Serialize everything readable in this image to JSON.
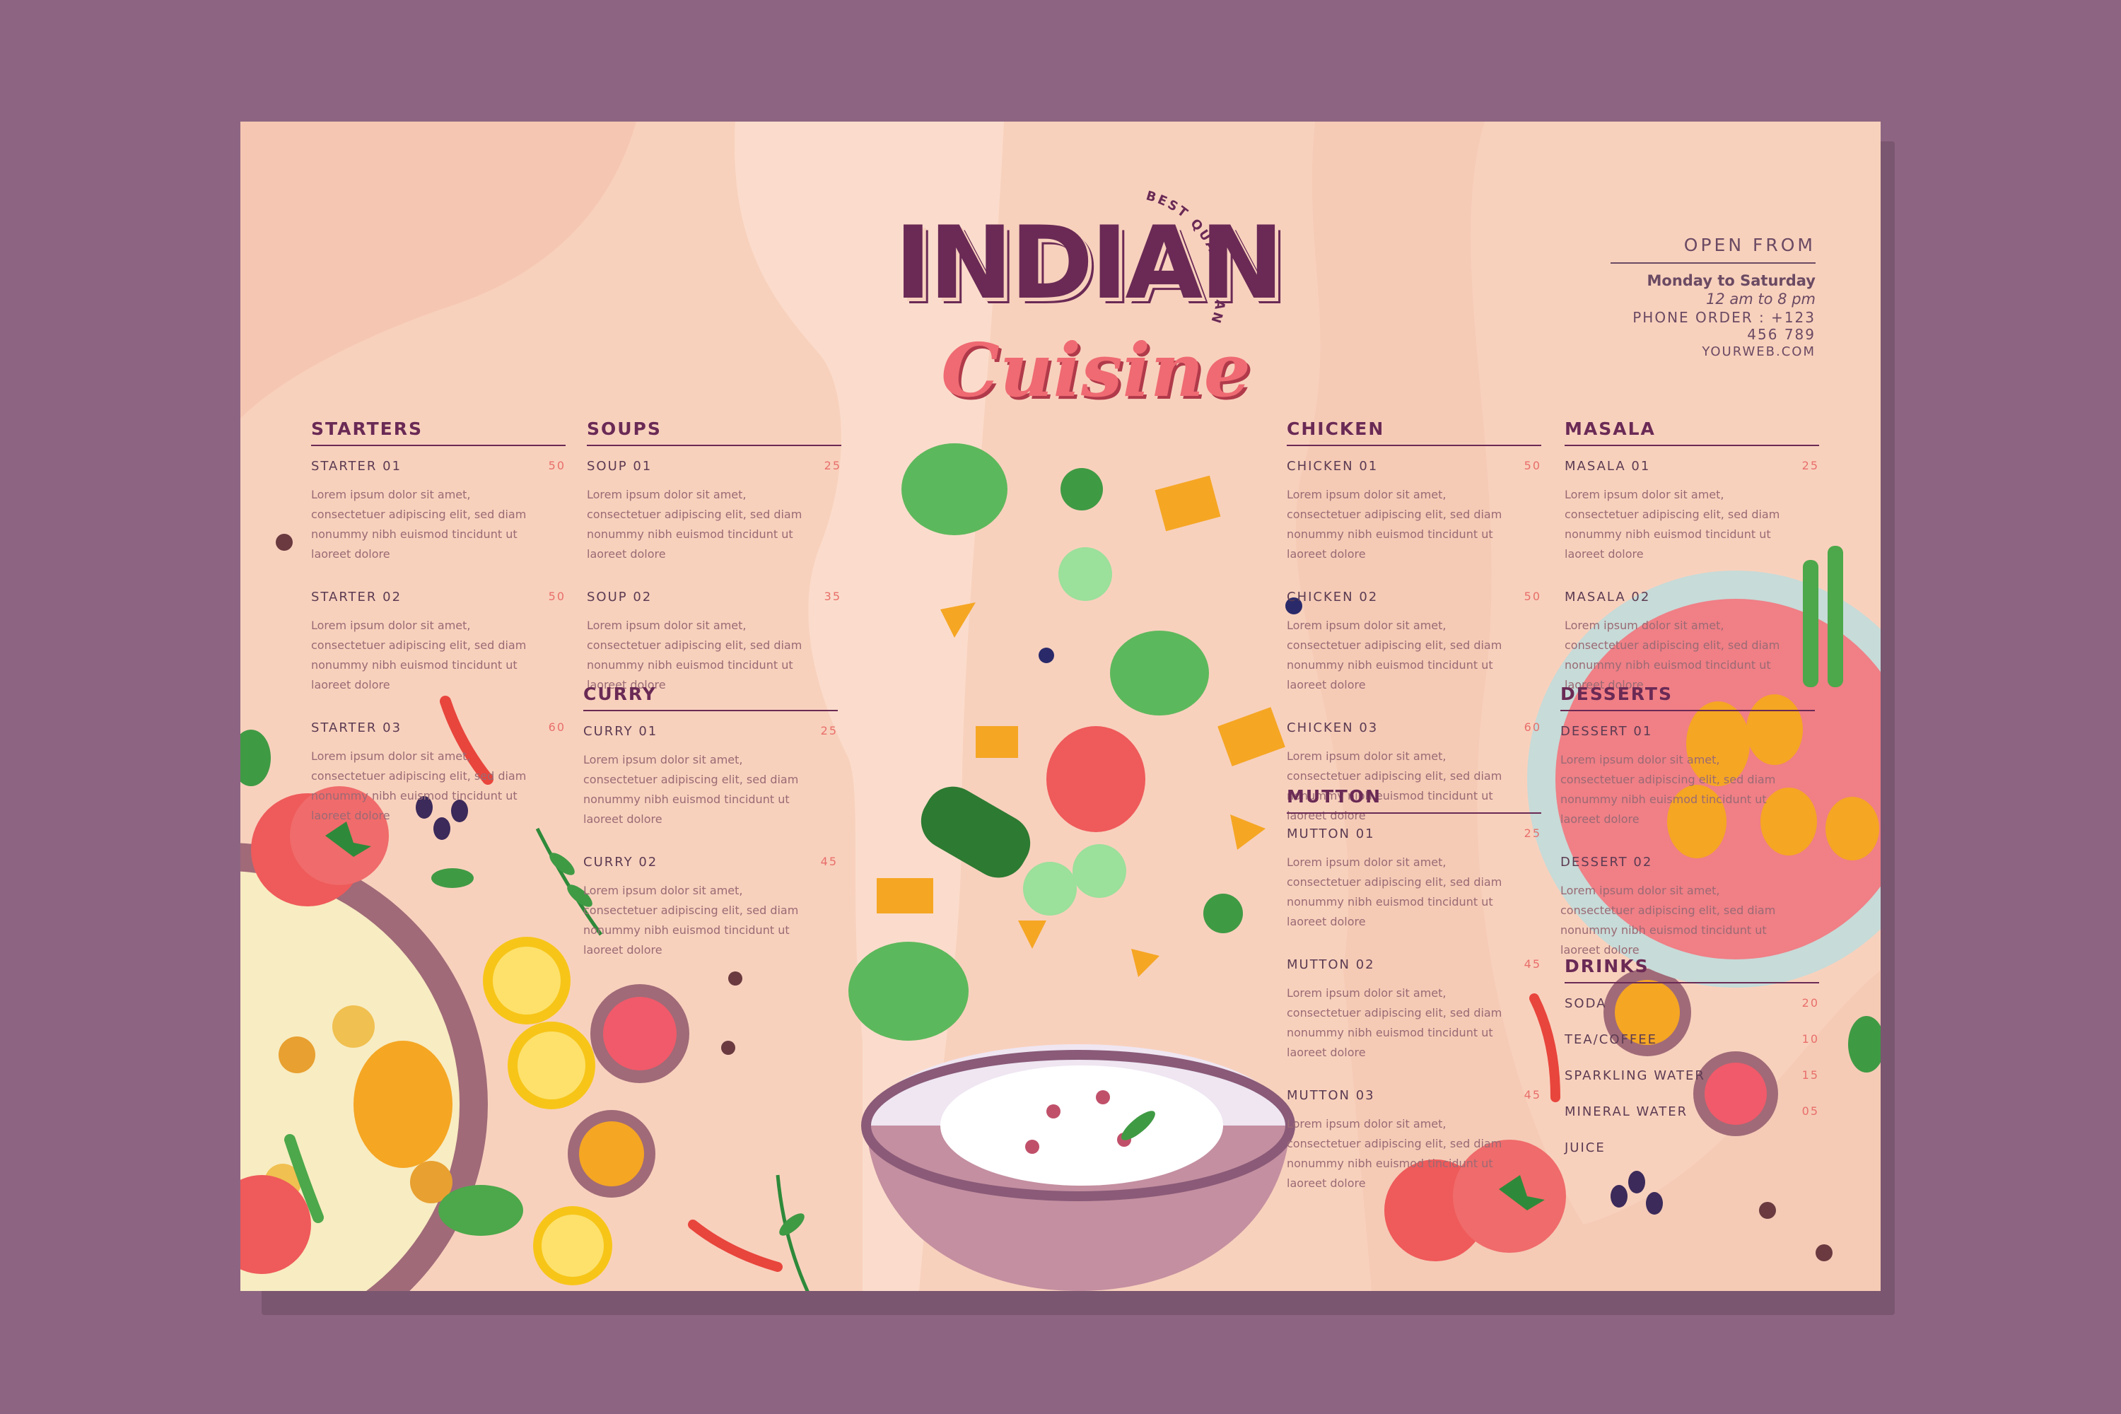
{
  "header": {
    "title_main": "INDIAN",
    "title_script": "Cuisine",
    "badge": "BEST QUALITY AND PRICE"
  },
  "info": {
    "heading": "OPEN FROM",
    "days": "Monday to Saturday",
    "hours": "12 am to 8 pm",
    "phone": "PHONE ORDER : +123 456 789",
    "web": "YOURWEB.COM"
  },
  "lorem": "Lorem ipsum dolor sit amet, consectetuer adipiscing elit, sed diam nonummy nibh euismod tincidunt ut laoreet dolore",
  "starters": {
    "title": "STARTERS",
    "items": [
      {
        "name": "STARTER 01",
        "price": "50",
        "desc": "Lorem ipsum dolor sit amet, consectetuer adipiscing elit, sed diam nonummy nibh euismod tincidunt ut laoreet dolore"
      },
      {
        "name": "STARTER 02",
        "price": "50",
        "desc": "Lorem ipsum dolor sit amet, consectetuer adipiscing elit, sed diam nonummy nibh euismod tincidunt ut laoreet dolore"
      },
      {
        "name": "STARTER 03",
        "price": "60",
        "desc": "Lorem ipsum dolor sit amet, consectetuer adipiscing elit, sed diam nonummy nibh euismod tincidunt ut laoreet dolore"
      }
    ]
  },
  "soups": {
    "title": "SOUPS",
    "items": [
      {
        "name": "SOUP 01",
        "price": "25",
        "desc": "Lorem ipsum dolor sit amet, consectetuer adipiscing elit, sed diam nonummy nibh euismod tincidunt ut laoreet dolore"
      },
      {
        "name": "SOUP 02",
        "price": "35",
        "desc": "Lorem ipsum dolor sit amet, consectetuer adipiscing elit, sed diam nonummy nibh euismod tincidunt ut laoreet dolore"
      }
    ]
  },
  "curry": {
    "title": "CURRY",
    "items": [
      {
        "name": "CURRY 01",
        "price": "25",
        "desc": "Lorem ipsum dolor sit amet, consectetuer adipiscing elit, sed diam nonummy nibh euismod tincidunt ut laoreet dolore"
      },
      {
        "name": "CURRY 02",
        "price": "45",
        "desc": "Lorem ipsum dolor sit amet, consectetuer adipiscing elit, sed diam nonummy nibh euismod tincidunt ut laoreet dolore"
      }
    ]
  },
  "chicken": {
    "title": "CHICKEN",
    "items": [
      {
        "name": "CHICKEN 01",
        "price": "50",
        "desc": "Lorem ipsum dolor sit amet, consectetuer adipiscing elit, sed diam nonummy nibh euismod tincidunt ut laoreet dolore"
      },
      {
        "name": "CHICKEN 02",
        "price": "50",
        "desc": "Lorem ipsum dolor sit amet, consectetuer adipiscing elit, sed diam nonummy nibh euismod tincidunt ut laoreet dolore"
      },
      {
        "name": "CHICKEN 03",
        "price": "60",
        "desc": "Lorem ipsum dolor sit amet, consectetuer adipiscing elit, sed diam nonummy nibh euismod tincidunt ut laoreet dolore"
      }
    ]
  },
  "mutton": {
    "title": "MUTTON",
    "items": [
      {
        "name": "MUTTON 01",
        "price": "25",
        "desc": "Lorem ipsum dolor sit amet, consectetuer adipiscing elit, sed diam nonummy nibh euismod tincidunt ut laoreet dolore"
      },
      {
        "name": "MUTTON 02",
        "price": "45",
        "desc": "Lorem ipsum dolor sit amet, consectetuer adipiscing elit, sed diam nonummy nibh euismod tincidunt ut laoreet dolore"
      },
      {
        "name": "MUTTON  03",
        "price": "45",
        "desc": "Lorem ipsum dolor sit amet, consectetuer adipiscing elit, sed diam nonummy nibh euismod tincidunt ut laoreet dolore"
      }
    ]
  },
  "masala": {
    "title": "MASALA",
    "items": [
      {
        "name": "MASALA 01",
        "price": "25",
        "desc": "Lorem ipsum dolor sit amet, consectetuer adipiscing elit, sed diam nonummy nibh euismod tincidunt ut laoreet dolore"
      },
      {
        "name": "MASALA 02",
        "price": "",
        "desc": "Lorem ipsum dolor sit amet, consectetuer adipiscing elit, sed diam nonummy nibh euismod tincidunt ut laoreet dolore"
      }
    ]
  },
  "desserts": {
    "title": "DESSERTS",
    "items": [
      {
        "name": "DESSERT 01",
        "price": "",
        "desc": "Lorem ipsum dolor sit amet, consectetuer adipiscing elit, sed diam nonummy nibh euismod tincidunt ut laoreet dolore"
      },
      {
        "name": "DESSERT 02",
        "price": "",
        "desc": "Lorem ipsum dolor sit amet, consectetuer adipiscing elit, sed diam nonummy nibh euismod tincidunt ut laoreet dolore"
      }
    ]
  },
  "drinks": {
    "title": "DRINKS",
    "items": [
      {
        "name": "SODA",
        "price": "20"
      },
      {
        "name": "TEA/COFFEE",
        "price": "10"
      },
      {
        "name": "SPARKLING WATER",
        "price": "15"
      },
      {
        "name": "MINERAL WATER",
        "price": "05"
      },
      {
        "name": "JUICE",
        "price": ""
      }
    ]
  },
  "colors": {
    "background": "#8d6582",
    "paper": "#f8d1bd",
    "title": "#6a2a55",
    "accent": "#ef6a72"
  }
}
